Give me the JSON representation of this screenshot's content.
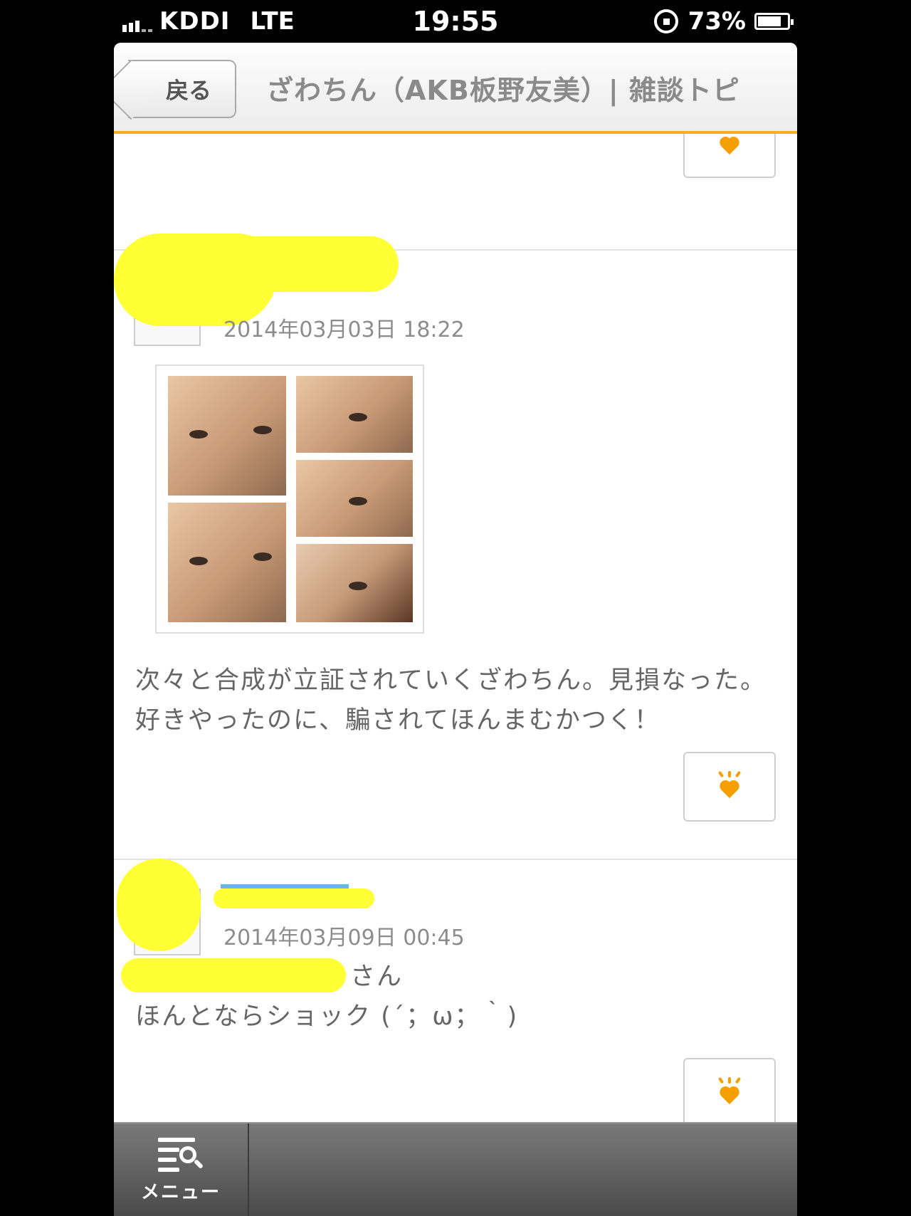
{
  "status_bar": {
    "carrier": "KDDI",
    "network": "LTE",
    "time": "19:55",
    "battery_percent": "73%"
  },
  "nav": {
    "back_label": "戻る",
    "title": "ざわちん（AKB板野友美）| 雑談トピ"
  },
  "posts": [
    {
      "timestamp": "2014年03月03日 18:22",
      "text": "次々と合成が立証されていくざわちん。見損なった。好きやったのに、騙されてほんまむかつく！"
    },
    {
      "timestamp": "2014年03月09日 00:45",
      "text_line1": "さん",
      "text_line2": "ほんとならショック (´；ω；｀)"
    }
  ],
  "bottom_bar": {
    "menu_label": "メニュー"
  },
  "colors": {
    "accent": "#f5a000",
    "nav_underline": "#f0b020",
    "redaction": "#ffff33"
  }
}
